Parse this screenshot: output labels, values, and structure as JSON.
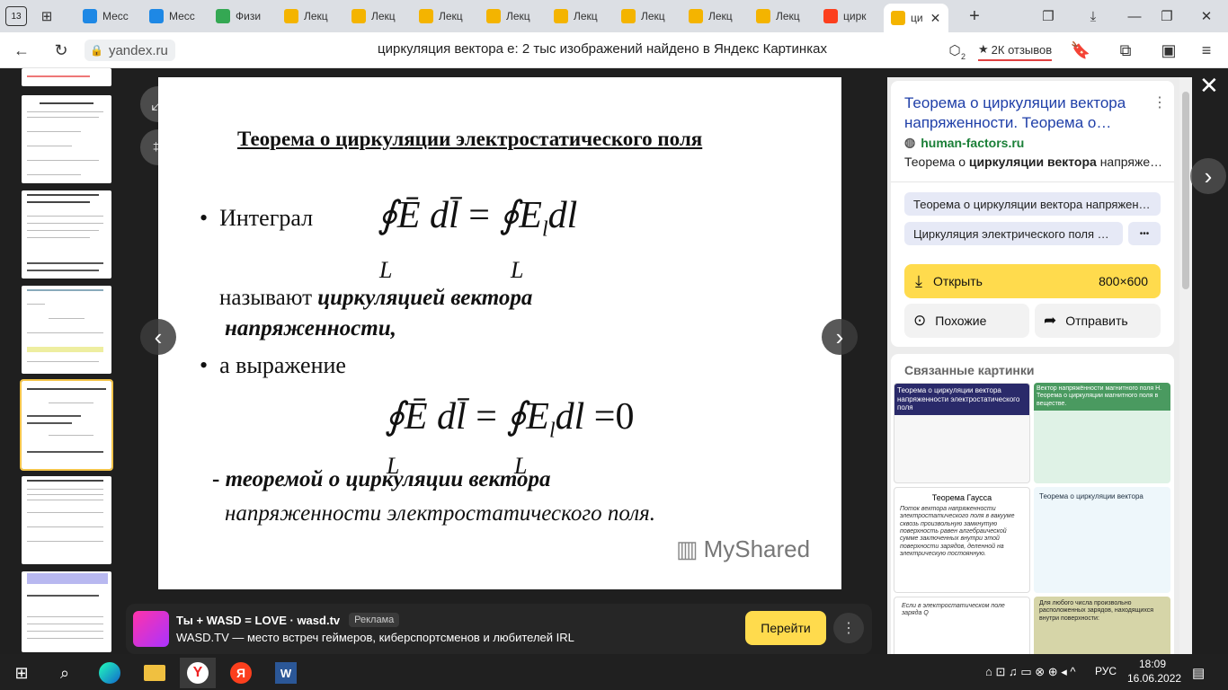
{
  "browser": {
    "tab_count": "13",
    "tabs": [
      {
        "label": "Месс",
        "icon": "messenger-icon",
        "color": "#1e88e5"
      },
      {
        "label": "Месс",
        "icon": "messenger-icon",
        "color": "#1e88e5"
      },
      {
        "label": "Физи",
        "icon": "google-drive-icon",
        "color": "#34a853"
      },
      {
        "label": "Лекц",
        "icon": "slides-icon",
        "color": "#f4b400"
      },
      {
        "label": "Лекц",
        "icon": "slides-icon",
        "color": "#f4b400"
      },
      {
        "label": "Лекц",
        "icon": "slides-icon",
        "color": "#f4b400"
      },
      {
        "label": "Лекц",
        "icon": "slides-icon",
        "color": "#f4b400"
      },
      {
        "label": "Лекц",
        "icon": "slides-icon",
        "color": "#f4b400"
      },
      {
        "label": "Лекц",
        "icon": "slides-icon",
        "color": "#f4b400"
      },
      {
        "label": "Лекц",
        "icon": "slides-icon",
        "color": "#f4b400"
      },
      {
        "label": "Лекц",
        "icon": "slides-icon",
        "color": "#f4b400"
      },
      {
        "label": "цирк",
        "icon": "yandex-icon",
        "color": "#fc3f1d"
      },
      {
        "label": "ци",
        "icon": "image-icon",
        "color": "#f4b400"
      }
    ],
    "domain": "yandex.ru",
    "page_title": "циркуляция вектора е: 2 тыс изображений найдено в Яндекс Картинках",
    "reviews": "2К отзывов",
    "shield_count": "2"
  },
  "slide": {
    "heading": "Теорема о циркуляции электростатического поля",
    "bullet1": "Интеграл",
    "formula1_left": "∮Ē dl̄",
    "formula1_right": "∮E",
    "formula_sub": "l",
    "formula_dl": "dl",
    "formula_eq": "=",
    "formula_zero": "=0",
    "contour": "L",
    "called": "называют",
    "circulation": "циркуляцией вектора",
    "intensity": "напряженности,",
    "bullet2": "а выражение",
    "theorem_dash": "- ",
    "theorem_bold": "теоремой о циркуляции вектора",
    "theorem_rest": "напряженности электростатического поля.",
    "watermark": "MyShared"
  },
  "panel": {
    "title": "Теорема о циркуляции вектора напряженности. Теорема о…",
    "site": "human-factors.ru",
    "snippet_pre": "Теорема о ",
    "snippet_bold": "циркуляции вектора",
    "snippet_post": " напряже…",
    "chip1": "Теорема о циркуляции вектора напряжен…",
    "chip2": "Циркуляция электрического поля …",
    "chip_more": "•••",
    "open_label": "Открыть",
    "size": "800×600",
    "similar_label": "Похожие",
    "share_label": "Отправить",
    "related_title": "Связанные картинки",
    "related": [
      {
        "title": "Теорема о циркуляции вектора напряженности электростатического поля"
      },
      {
        "title": "Вектор напряжённости магнитного поля Н. Теорема о циркуляции магнитного поля в веществе."
      },
      {
        "title": "Теорема Гаусса"
      },
      {
        "title": "Теорема о циркуляции вектора"
      },
      {
        "title": "Если в электростатическом поле заряда Q"
      },
      {
        "title": "Для любого числа произвольно расположенных зарядов, находящихся внутри поверхности:"
      }
    ],
    "gauss_text": "Поток вектора напряженности электростатического поля в вакууме сквозь произвольную замкнутую поверхность равен алгебраической сумме заключенных внутри этой поверхности зарядов, деленной на электрическую постоянную."
  },
  "ad": {
    "title": "Ты + WASD = LOVE · wasd.tv",
    "badge": "Реклама",
    "subtitle": "WASD.TV — место встреч геймеров, киберспортсменов и любителей IRL",
    "button": "Перейти"
  },
  "taskbar": {
    "lang": "РУС",
    "time": "18:09",
    "date": "16.06.2022"
  },
  "colors": {
    "accent_yellow": "#ffdb4d",
    "link_blue": "#1f3fa8",
    "site_green": "#1a7f37"
  }
}
